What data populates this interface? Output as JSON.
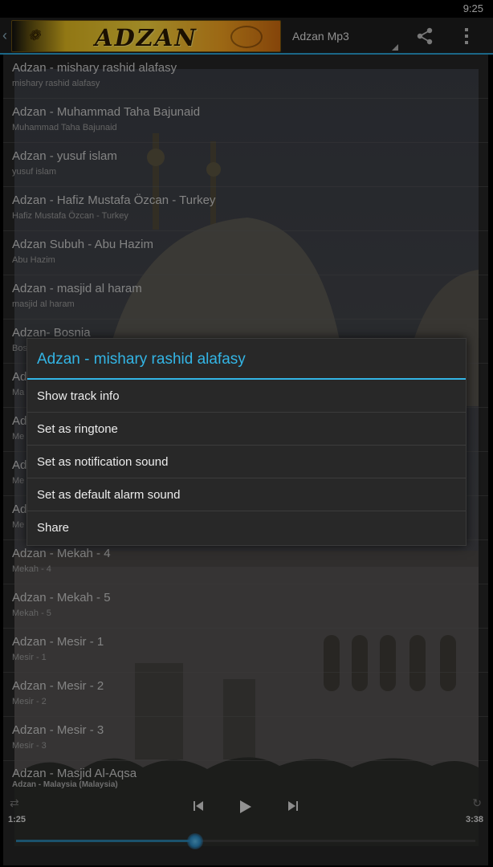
{
  "status_bar": {
    "time": "9:25"
  },
  "action_bar": {
    "logo_text": "ADZAN",
    "nav_selected": "Adzan Mp3",
    "icons": {
      "share": "share-icon",
      "overflow": "overflow-menu-icon"
    }
  },
  "tracks": [
    {
      "title": "Adzan - mishary rashid alafasy",
      "subtitle": "mishary rashid alafasy"
    },
    {
      "title": "Adzan - Muhammad Taha Bajunaid",
      "subtitle": "Muhammad Taha Bajunaid"
    },
    {
      "title": "Adzan - yusuf islam",
      "subtitle": "yusuf islam"
    },
    {
      "title": "Adzan - Hafiz Mustafa Özcan - Turkey",
      "subtitle": "Hafiz Mustafa Özcan - Turkey"
    },
    {
      "title": "Adzan Subuh - Abu Hazim",
      "subtitle": "Abu Hazim"
    },
    {
      "title": "Adzan - masjid al haram",
      "subtitle": "masjid al haram"
    },
    {
      "title": "Adzan- Bosnia",
      "subtitle": "Bos"
    },
    {
      "title": "Ad",
      "subtitle": "Ma"
    },
    {
      "title": "Ad",
      "subtitle": "Me"
    },
    {
      "title": "Ad",
      "subtitle": "Me"
    },
    {
      "title": "Ad",
      "subtitle": "Me"
    },
    {
      "title": "Adzan - Mekah - 4",
      "subtitle": "Mekah - 4"
    },
    {
      "title": "Adzan - Mekah - 5",
      "subtitle": "Mekah - 5"
    },
    {
      "title": "Adzan - Mesir - 1",
      "subtitle": "Mesir - 1"
    },
    {
      "title": "Adzan - Mesir - 2",
      "subtitle": "Mesir - 2"
    },
    {
      "title": "Adzan - Mesir - 3",
      "subtitle": "Mesir - 3"
    }
  ],
  "player": {
    "now_playing_title": "Adzan - Masjid Al-Aqsa",
    "now_playing_sub": "Adzan - Malaysia (Malaysia)",
    "elapsed": "1:25",
    "total": "3:38",
    "progress": 0.39,
    "icons": {
      "shuffle": "shuffle-icon",
      "repeat": "repeat-icon",
      "prev": "previous-icon",
      "play": "play-icon",
      "next": "next-icon"
    }
  },
  "dialog": {
    "title": "Adzan - mishary rashid alafasy",
    "items": [
      "Show track info",
      "Set as ringtone",
      "Set as notification sound",
      "Set as default alarm sound",
      "Share"
    ]
  },
  "colors": {
    "accent": "#33b5e5",
    "seek": "#2a7fa8"
  }
}
